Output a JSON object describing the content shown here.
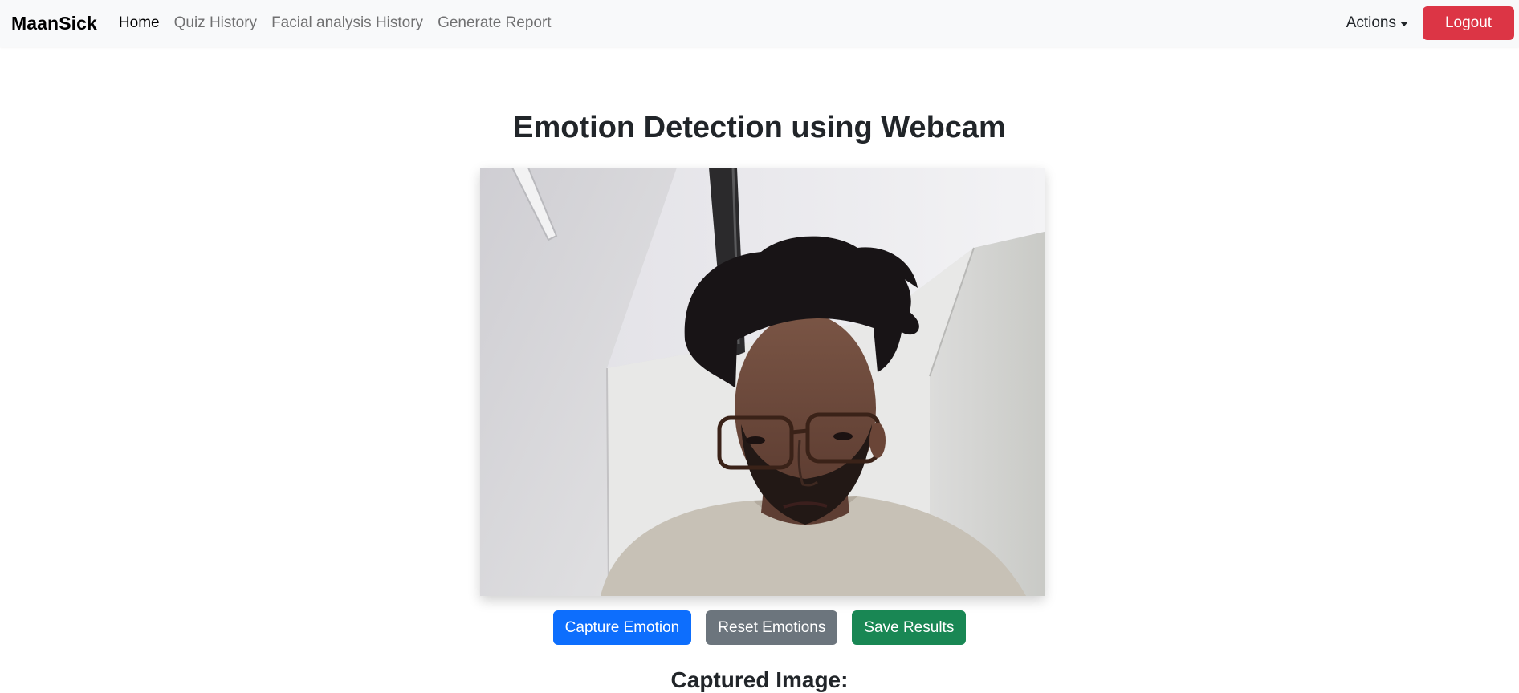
{
  "navbar": {
    "brand": "MaanSick",
    "links": [
      {
        "label": "Home",
        "active": true
      },
      {
        "label": "Quiz History",
        "active": false
      },
      {
        "label": "Facial analysis History",
        "active": false
      },
      {
        "label": "Generate Report",
        "active": false
      }
    ],
    "actions_label": "Actions",
    "logout_label": "Logout"
  },
  "main": {
    "title": "Emotion Detection using Webcam",
    "buttons": {
      "capture": "Capture Emotion",
      "reset": "Reset Emotions",
      "save": "Save Results"
    },
    "captured_heading": "Captured Image:"
  },
  "colors": {
    "navbar_bg": "#f8f9fa",
    "logout": "#dc3545",
    "capture": "#0d6efd",
    "reset": "#6c757d",
    "save": "#198754"
  }
}
